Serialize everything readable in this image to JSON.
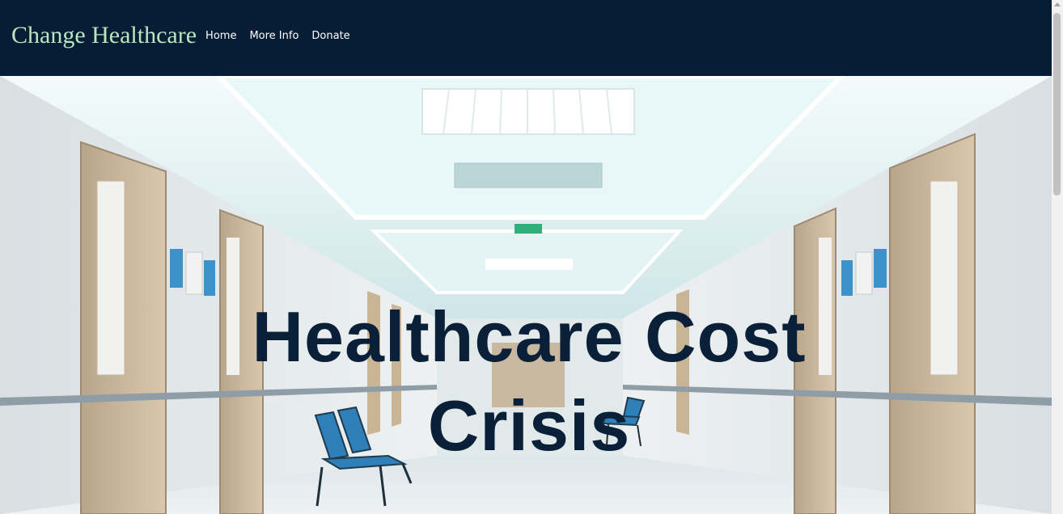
{
  "brand": "Change Healthcare",
  "nav": {
    "links": [
      "Home",
      "More Info",
      "Donate"
    ]
  },
  "hero": {
    "title_line1": "Healthcare Cost",
    "title_line2": "Crisis",
    "background": "hospital-corridor"
  },
  "colors": {
    "navbar": "#071d36",
    "brand": "#b9e6bd",
    "nav_text": "#ffffff",
    "hero_title": "#0a1f38"
  }
}
